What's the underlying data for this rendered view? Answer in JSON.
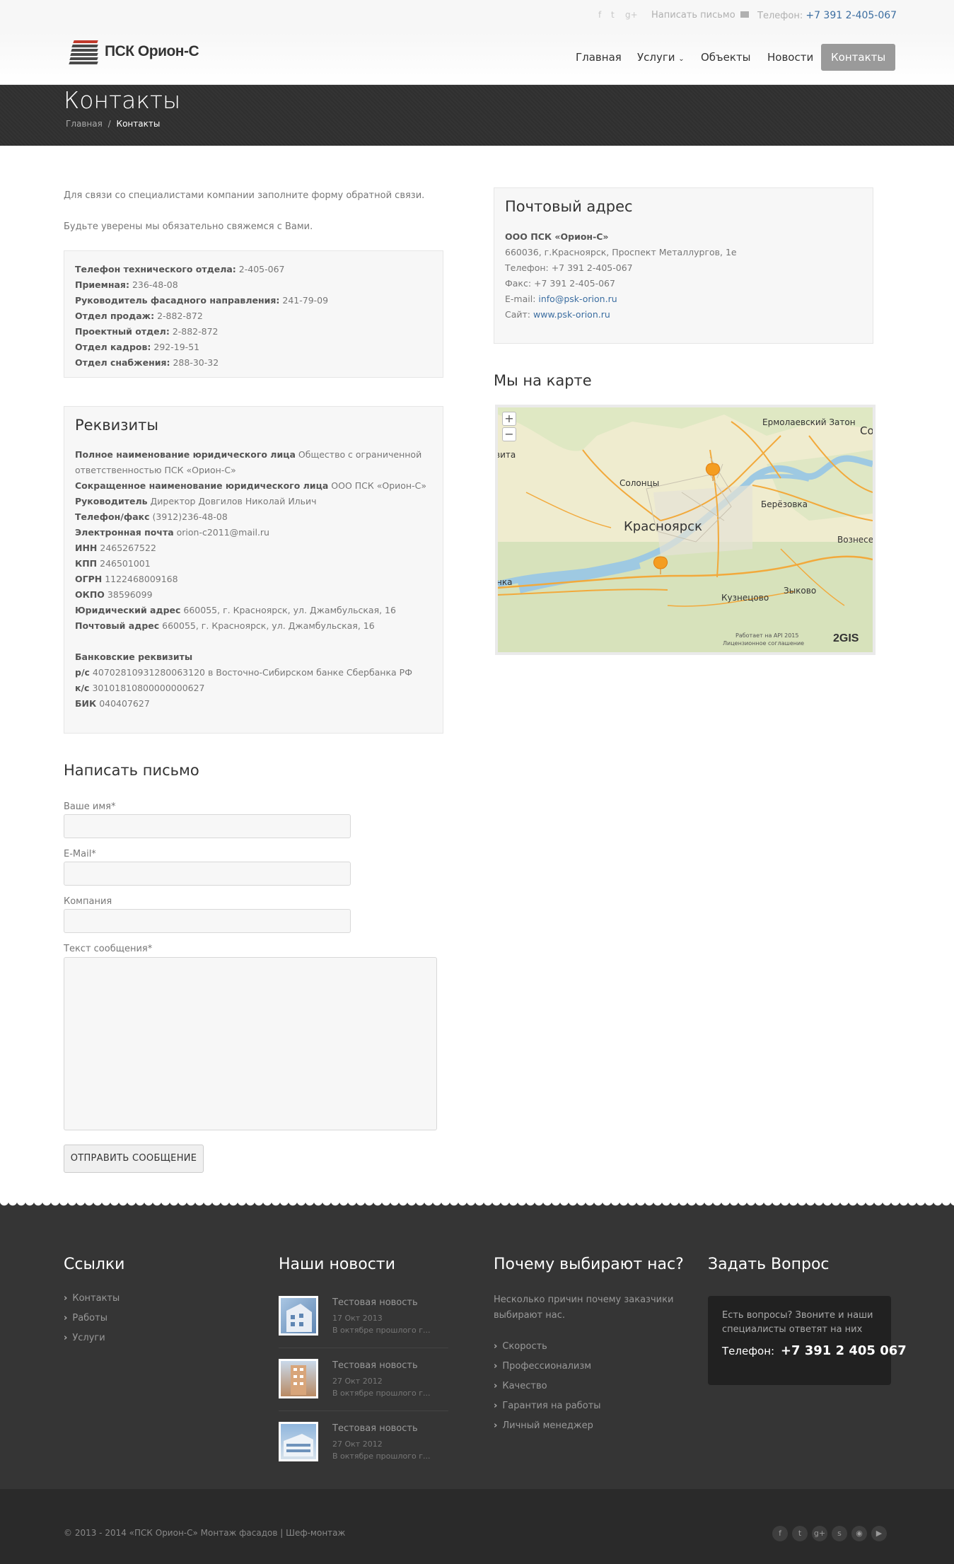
{
  "topbar": {
    "write_label": "Написать письмо",
    "phone_label": "Телефон:",
    "phone_value": "+7 391 2-405-067"
  },
  "brand": {
    "name": "ПСК Орион-С"
  },
  "nav": {
    "items": [
      {
        "label": "Главная"
      },
      {
        "label": "Услуги"
      },
      {
        "label": "Объекты"
      },
      {
        "label": "Новости"
      },
      {
        "label": "Контакты"
      }
    ]
  },
  "page": {
    "title": "Контакты",
    "breadcrumb": {
      "home": "Главная",
      "sep": "/",
      "current": "Контакты"
    }
  },
  "intro": {
    "line1": "Для связи со специалистами компании заполните форму обратной связи.",
    "line2": "Будьте уверены мы обязательно свяжемся с Вами."
  },
  "phones": [
    {
      "label": "Телефон технического отдела:",
      "value": "2-405-067"
    },
    {
      "label": "Приемная:",
      "value": "236-48-08"
    },
    {
      "label": "Руководитель фасадного направления:",
      "value": "241-79-09"
    },
    {
      "label": "Отдел продаж:",
      "value": "2-882-872"
    },
    {
      "label": "Проектный отдел:",
      "value": "2-882-872"
    },
    {
      "label": "Отдел кадров:",
      "value": "292-19-51"
    },
    {
      "label": "Отдел снабжения:",
      "value": "288-30-32"
    }
  ],
  "requisites": {
    "title": "Реквизиты",
    "full_name_label": "Полное наименование юридического лица",
    "full_name_value1": "Общество с ограниченной",
    "full_name_value2": "ответственностью ПСК «Орион-С»",
    "rows": [
      {
        "label": "Сокращенное наименование юридического лица",
        "value": "ООО ПСК «Орион-С»"
      },
      {
        "label": "Руководитель",
        "value": "Директор Довгилов Николай Ильич"
      },
      {
        "label": "Телефон/факс",
        "value": "(3912)236-48-08"
      },
      {
        "label": "Электронная почта",
        "value": "orion-c2011@mail.ru"
      },
      {
        "label": "ИНН",
        "value": "2465267522"
      },
      {
        "label": "КПП",
        "value": "246501001"
      },
      {
        "label": "ОГРН",
        "value": "1122468009168"
      },
      {
        "label": "ОКПО",
        "value": "38596099"
      },
      {
        "label": "Юридический адрес",
        "value": "660055, г. Красноярск, ул. Джамбульская, 16"
      },
      {
        "label": "Почтовый адрес",
        "value": "660055, г. Красноярск, ул. Джамбульская, 16"
      }
    ],
    "bank_title": "Банковские реквизиты",
    "bank_rows": [
      {
        "label": "р/с",
        "value": "40702810931280063120 в Восточно-Сибирском банке Сбербанка РФ"
      },
      {
        "label": "к/с",
        "value": "30101810800000000627"
      },
      {
        "label": "БИК",
        "value": "040407627"
      }
    ]
  },
  "postal": {
    "title": "Почтовый адрес",
    "company": "ООО ПСК «Орион-С»",
    "address": "660036, г.Красноярск, Проспект Металлургов, 1е",
    "phone": "Телефон: +7 391 2-405-067",
    "fax": "Факс: +7 391 2-405-067",
    "email_label": "E-mail:",
    "email": "info@psk-orion.ru",
    "site_label": "Сайт:",
    "site": "www.psk-orion.ru"
  },
  "map": {
    "title": "Мы на карте",
    "zoom_in": "+",
    "zoom_out": "−",
    "labels": {
      "zaton": "Ермолаевский Затон",
      "so": "Со",
      "solontsy": "Солонцы",
      "city": "Красноярск",
      "berezovka": "Берёзовка",
      "voznesen": "Вознесен",
      "kuznetsovo": "Кузнецово",
      "zykovo": "Зыково",
      "vita": "вита",
      "anka": "нка"
    },
    "attribution1": "Работает на API 2015",
    "attribution2": "Лицензионное соглашение",
    "provider": "2GIS"
  },
  "form": {
    "title": "Написать письмо",
    "name_label": "Ваше имя*",
    "email_label": "E-Mail*",
    "company_label": "Компания",
    "message_label": "Текст сообщения*",
    "submit": "ОТПРАВИТЬ СООБЩЕНИЕ"
  },
  "footer": {
    "links": {
      "title": "Ссылки",
      "items": [
        "Контакты",
        "Работы",
        "Услуги"
      ]
    },
    "news": {
      "title": "Наши новости",
      "items": [
        {
          "title": "Тестовая новость",
          "date": "17 Окт 2013",
          "excerpt": "В октябре прошлого г..."
        },
        {
          "title": "Тестовая новость",
          "date": "27 Окт 2012",
          "excerpt": "В октябре прошлого г..."
        },
        {
          "title": "Тестовая новость",
          "date": "27 Окт 2012",
          "excerpt": "В октябре прошлого г..."
        }
      ]
    },
    "why": {
      "title": "Почему выбирают нас?",
      "text1": "Несколько причин почему заказчики",
      "text2": "выбирают нас.",
      "items": [
        "Скорость",
        "Профессионализм",
        "Качество",
        "Гарантия на работы",
        "Личный менеджер"
      ]
    },
    "ask": {
      "title": "Задать Вопрос",
      "text1": "Есть вопросы? Звоните и наши",
      "text2": "специалисты ответят на них",
      "phone_label": "Телефон:",
      "phone": "+7 391 2 405 067"
    },
    "copyright": "© 2013 - 2014 «ПСК Орион-С» Монтаж фасадов | Шеф-монтаж"
  }
}
